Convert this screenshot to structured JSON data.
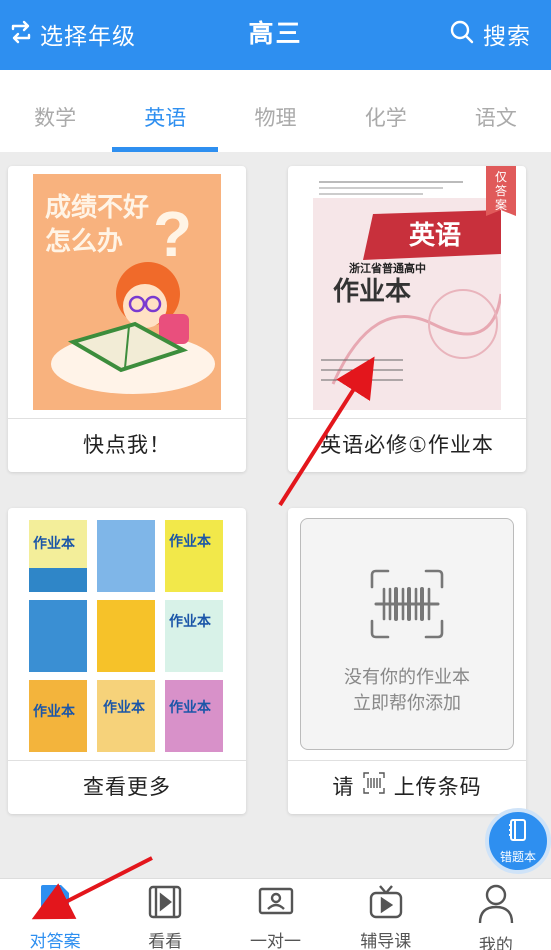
{
  "header": {
    "grade_switch_label": "选择年级",
    "title": "高三",
    "search_label": "搜索"
  },
  "tabs": [
    {
      "label": "数学",
      "active": false
    },
    {
      "label": "英语",
      "active": true
    },
    {
      "label": "物理",
      "active": false
    },
    {
      "label": "化学",
      "active": false
    },
    {
      "label": "语文",
      "active": false
    }
  ],
  "cards": [
    {
      "caption": "快点我！",
      "image_text": "成绩不好\n怎么办"
    },
    {
      "caption": "英语必修①作业本",
      "flag": "仅答案",
      "cover_title": "英语",
      "cover_subtitle": "作业本",
      "cover_header": "浙江省普通高中"
    },
    {
      "caption": "查看更多",
      "book_label": "作业本"
    },
    {
      "caption_prefix": "请",
      "caption_suffix": "上传条码",
      "upload_line1": "没有你的作业本",
      "upload_line2": "立即帮你添加"
    }
  ],
  "fab": {
    "label": "错题本"
  },
  "bottom_nav": [
    {
      "label": "对答案",
      "icon": "answer-doc-icon",
      "active": true
    },
    {
      "label": "看看",
      "icon": "video-play-icon",
      "active": false
    },
    {
      "label": "一对一",
      "icon": "person-card-icon",
      "active": false
    },
    {
      "label": "辅导课",
      "icon": "tv-icon",
      "active": false
    },
    {
      "label": "我的",
      "icon": "user-icon",
      "active": false
    }
  ],
  "colors": {
    "brand": "#2e8ff0",
    "flag": "#e05a5a",
    "annotation": "#e3161c"
  }
}
